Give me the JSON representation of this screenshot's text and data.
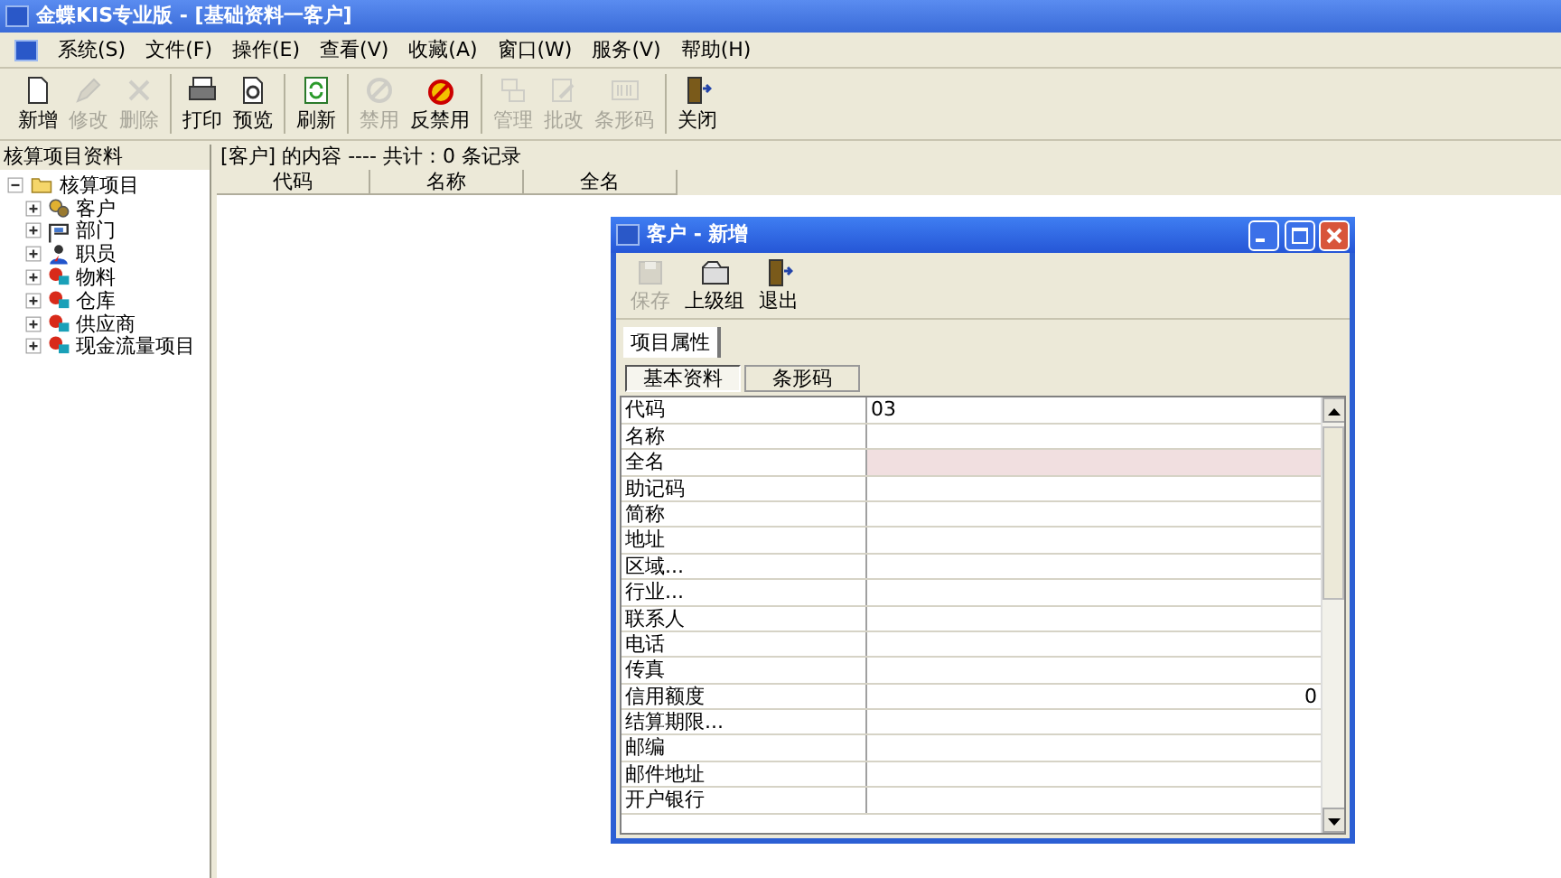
{
  "window": {
    "title": "金蝶KIS专业版 - [基础资料一客户]"
  },
  "menu": [
    {
      "label": "系统(S)"
    },
    {
      "label": "文件(F)"
    },
    {
      "label": "操作(E)"
    },
    {
      "label": "查看(V)"
    },
    {
      "label": "收藏(A)"
    },
    {
      "label": "窗口(W)"
    },
    {
      "label": "服务(V)"
    },
    {
      "label": "帮助(H)"
    }
  ],
  "toolbar": [
    [
      {
        "label": "新增",
        "disabled": false
      },
      {
        "label": "修改",
        "disabled": true
      },
      {
        "label": "删除",
        "disabled": true
      }
    ],
    [
      {
        "label": "打印",
        "disabled": false
      },
      {
        "label": "预览",
        "disabled": false
      }
    ],
    [
      {
        "label": "刷新",
        "disabled": false
      }
    ],
    [
      {
        "label": "禁用",
        "disabled": true
      },
      {
        "label": "反禁用",
        "disabled": false
      }
    ],
    [
      {
        "label": "管理",
        "disabled": true
      },
      {
        "label": "批改",
        "disabled": true
      },
      {
        "label": "条形码",
        "disabled": true
      }
    ],
    [
      {
        "label": "关闭",
        "disabled": false
      }
    ]
  ],
  "sidebar": {
    "title": "核算项目资料",
    "tree": {
      "label": "核算项目",
      "expanded": true,
      "children": [
        {
          "label": "客户",
          "expanded": false
        },
        {
          "label": "部门",
          "expanded": false
        },
        {
          "label": "职员",
          "expanded": false
        },
        {
          "label": "物料",
          "expanded": false
        },
        {
          "label": "仓库",
          "expanded": false
        },
        {
          "label": "供应商",
          "expanded": false
        },
        {
          "label": "现金流量项目",
          "expanded": false
        }
      ]
    }
  },
  "list": {
    "summary": "[客户] 的内容 ---- 共计：0 条记录",
    "columns": [
      "代码",
      "名称",
      "全名"
    ]
  },
  "dialog": {
    "title": "客户 - 新增",
    "toolbar": [
      {
        "label": "保存",
        "disabled": true
      },
      {
        "label": "上级组",
        "disabled": false
      },
      {
        "label": "退出",
        "disabled": false
      }
    ],
    "tabs": [
      {
        "label": "项目属性",
        "selected": true
      }
    ],
    "subtabs": [
      {
        "label": "基本资料",
        "selected": true
      },
      {
        "label": "条形码",
        "selected": false
      }
    ],
    "rows": [
      {
        "label": "代码",
        "value": "03",
        "kind": "text",
        "highlighted": false
      },
      {
        "label": "名称",
        "kind": "text",
        "highlighted": false
      },
      {
        "label": "全名",
        "kind": "text",
        "highlighted": true
      },
      {
        "label": "助记码",
        "kind": "text",
        "highlighted": false
      },
      {
        "label": "简称",
        "kind": "text",
        "highlighted": false
      },
      {
        "label": "地址",
        "kind": "text",
        "highlighted": false
      },
      {
        "label": "区域...",
        "kind": "text",
        "highlighted": false
      },
      {
        "label": "行业...",
        "kind": "text",
        "highlighted": false
      },
      {
        "label": "联系人",
        "kind": "text",
        "highlighted": false
      },
      {
        "label": "电话",
        "kind": "text",
        "highlighted": false
      },
      {
        "label": "传真",
        "kind": "text",
        "highlighted": false
      },
      {
        "label": "信用额度",
        "value": "0",
        "kind": "number",
        "highlighted": false
      },
      {
        "label": "结算期限...",
        "kind": "text",
        "highlighted": false
      },
      {
        "label": "邮编",
        "kind": "text",
        "highlighted": false
      },
      {
        "label": "邮件地址",
        "kind": "text",
        "highlighted": false
      },
      {
        "label": "开户银行",
        "kind": "text",
        "highlighted": false
      }
    ]
  }
}
